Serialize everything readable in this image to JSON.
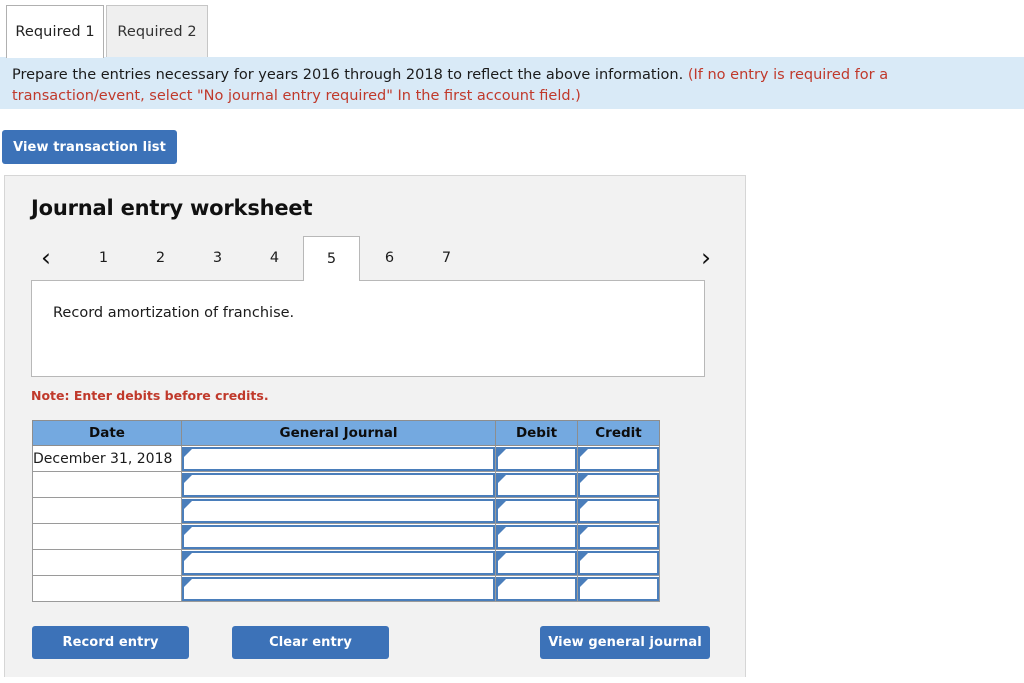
{
  "required_tabs": [
    {
      "label": "Required 1",
      "active": true
    },
    {
      "label": "Required 2",
      "active": false
    }
  ],
  "instruction": {
    "main": "Prepare the entries necessary for years 2016 through 2018 to reflect the above information.",
    "hint": "(If no entry is required for a transaction/event, select \"No journal entry required\" In the first account field.)"
  },
  "toolbar": {
    "view_transaction_list_label": "View transaction list"
  },
  "worksheet": {
    "title": "Journal entry worksheet",
    "pager": {
      "prev_icon": "chevron-left-icon",
      "next_icon": "chevron-right-icon",
      "prev_glyph": "‹",
      "next_glyph": "›",
      "pages": [
        "1",
        "2",
        "3",
        "4",
        "5",
        "6",
        "7"
      ],
      "active_page": "5"
    },
    "prompt": "Record amortization of franchise.",
    "note": "Note: Enter debits before credits.",
    "table": {
      "headers": [
        "Date",
        "General Journal",
        "Debit",
        "Credit"
      ],
      "rows": [
        {
          "date": "December 31, 2018",
          "general_journal": "",
          "debit": "",
          "credit": ""
        },
        {
          "date": "",
          "general_journal": "",
          "debit": "",
          "credit": ""
        },
        {
          "date": "",
          "general_journal": "",
          "debit": "",
          "credit": ""
        },
        {
          "date": "",
          "general_journal": "",
          "debit": "",
          "credit": ""
        },
        {
          "date": "",
          "general_journal": "",
          "debit": "",
          "credit": ""
        },
        {
          "date": "",
          "general_journal": "",
          "debit": "",
          "credit": ""
        }
      ]
    },
    "footer": {
      "record_entry_label": "Record entry",
      "clear_entry_label": "Clear entry",
      "view_general_journal_label": "View general journal"
    }
  },
  "colors": {
    "button_blue": "#3c72b8",
    "header_blue": "#74a9e0",
    "banner_blue": "#d9eaf7",
    "panel_gray": "#f2f2f2",
    "alert_red": "#c0392b",
    "input_border_blue": "#4a7ebb"
  }
}
